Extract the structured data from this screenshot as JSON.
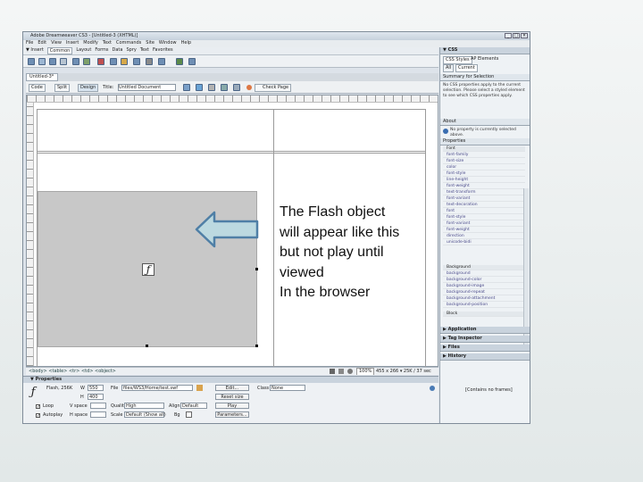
{
  "window": {
    "title": "Adobe Dreamweaver CS3 - [Untitled-3 (XHTML)]",
    "controls": [
      "_",
      "□",
      "×"
    ]
  },
  "menubar": [
    "File",
    "Edit",
    "View",
    "Insert",
    "Modify",
    "Text",
    "Commands",
    "Site",
    "Window",
    "Help"
  ],
  "insertbar": {
    "prefix": "▼ Insert",
    "tabs": [
      "Common",
      "Layout",
      "Forms",
      "Data",
      "Spry",
      "Text",
      "Favorites"
    ]
  },
  "document": {
    "tab_label": "Untitled-3*",
    "view_buttons": [
      "Code",
      "Split",
      "Design"
    ],
    "title_label": "Title:",
    "title_value": "Untitled Document",
    "check_page_label": "Check Page"
  },
  "statusbar": {
    "tag_selector": "<body> <table> <tr> <td> <object>",
    "zoom": "100%",
    "size_info": "455 x 266 ▾ 25K / 37 sec"
  },
  "properties": {
    "header": "▼ Properties",
    "object_name": "Flash, 256K",
    "w_label": "W",
    "w_value": "550",
    "h_label": "H",
    "h_value": "400",
    "file_label": "File",
    "file_value": "files/WS3/Home/test.swf",
    "edit_button": "Edit...",
    "reset_size_button": "Reset size",
    "class_label": "Class",
    "class_value": "None",
    "loop_label": "Loop",
    "vspace_label": "V space",
    "quality_label": "Quality",
    "quality_value": "High",
    "align_label": "Align",
    "align_value": "Default",
    "play_button": "Play",
    "autoplay_label": "Autoplay",
    "hspace_label": "H space",
    "scale_label": "Scale",
    "scale_value": "Default (Show all)",
    "bg_label": "Bg",
    "parameters_button": "Parameters..."
  },
  "right_panel": {
    "css_header": "▼ CSS",
    "css_tabs": [
      "CSS Styles",
      "AP Elements"
    ],
    "mode_tabs": [
      "All",
      "Current"
    ],
    "summary_header": "Summary for Selection",
    "summary_text": "No CSS properties apply to the current selection. Please select a styled element to see which CSS properties apply.",
    "about_header": "About",
    "about_text": "No property is currently selected above.",
    "properties_header": "Properties",
    "group_font": "Font",
    "font_props": [
      "font-family",
      "font-size",
      "color",
      "font-style",
      "line-height",
      "font-weight",
      "text-transform",
      "font-variant",
      "text-decoration",
      "font",
      "font-style",
      "font-variant",
      "font-weight",
      "direction",
      "unicode-bidi"
    ],
    "group_background": "Background",
    "background_props": [
      "background",
      "background-color",
      "background-image",
      "background-repeat",
      "background-attachment",
      "background-position"
    ],
    "group_block": "Block",
    "collapsed_panels": [
      "▶ Application",
      "▶ Tag Inspector",
      "▶ Files",
      "▶ History"
    ],
    "history_text": "[Contains no frames]"
  },
  "annotation": {
    "text": "The Flash object\nwill appear like this\nbut not play until\nviewed\nIn the browser"
  },
  "colors": {
    "arrow_fill": "#bcd9e0",
    "arrow_stroke": "#4f7fa6",
    "flash_placeholder": "#c8c8c8"
  },
  "icons": {
    "flash_logo": "ƒ",
    "arrow": "left-arrow-icon"
  }
}
